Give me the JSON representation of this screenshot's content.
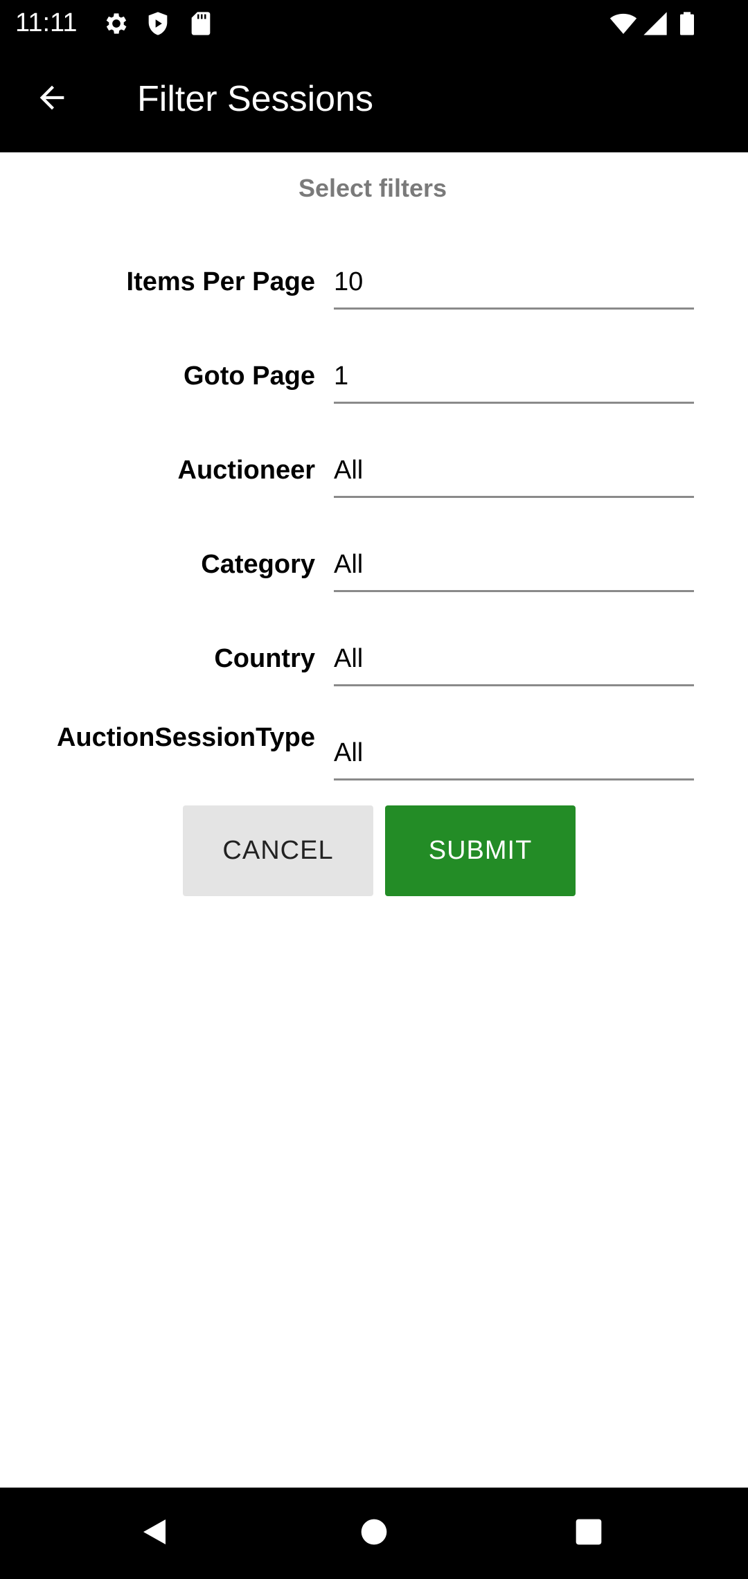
{
  "status_bar": {
    "time": "11:11",
    "left_icons": [
      "gear-icon",
      "shield-icon",
      "sd-card-icon"
    ],
    "right_icons": [
      "wifi-icon",
      "signal-icon",
      "battery-icon"
    ]
  },
  "app_bar": {
    "title": "Filter Sessions",
    "back_icon": "arrow-left-icon"
  },
  "form": {
    "subtitle": "Select filters",
    "fields": [
      {
        "label": "Items Per Page",
        "value": "10"
      },
      {
        "label": "Goto Page",
        "value": "1"
      },
      {
        "label": "Auctioneer",
        "value": "All"
      },
      {
        "label": "Category",
        "value": "All"
      },
      {
        "label": "Country",
        "value": "All"
      },
      {
        "label": "AuctionSessionType",
        "value": "All"
      }
    ],
    "cancel_label": "CANCEL",
    "submit_label": "SUBMIT"
  },
  "colors": {
    "bar_background": "#000000",
    "submit_green": "#238c26",
    "cancel_gray": "#e4e4e4",
    "subtitle_gray": "#7a7a7a"
  },
  "nav_bar": {
    "icons": [
      "back-triangle-icon",
      "home-circle-icon",
      "recents-square-icon"
    ]
  }
}
